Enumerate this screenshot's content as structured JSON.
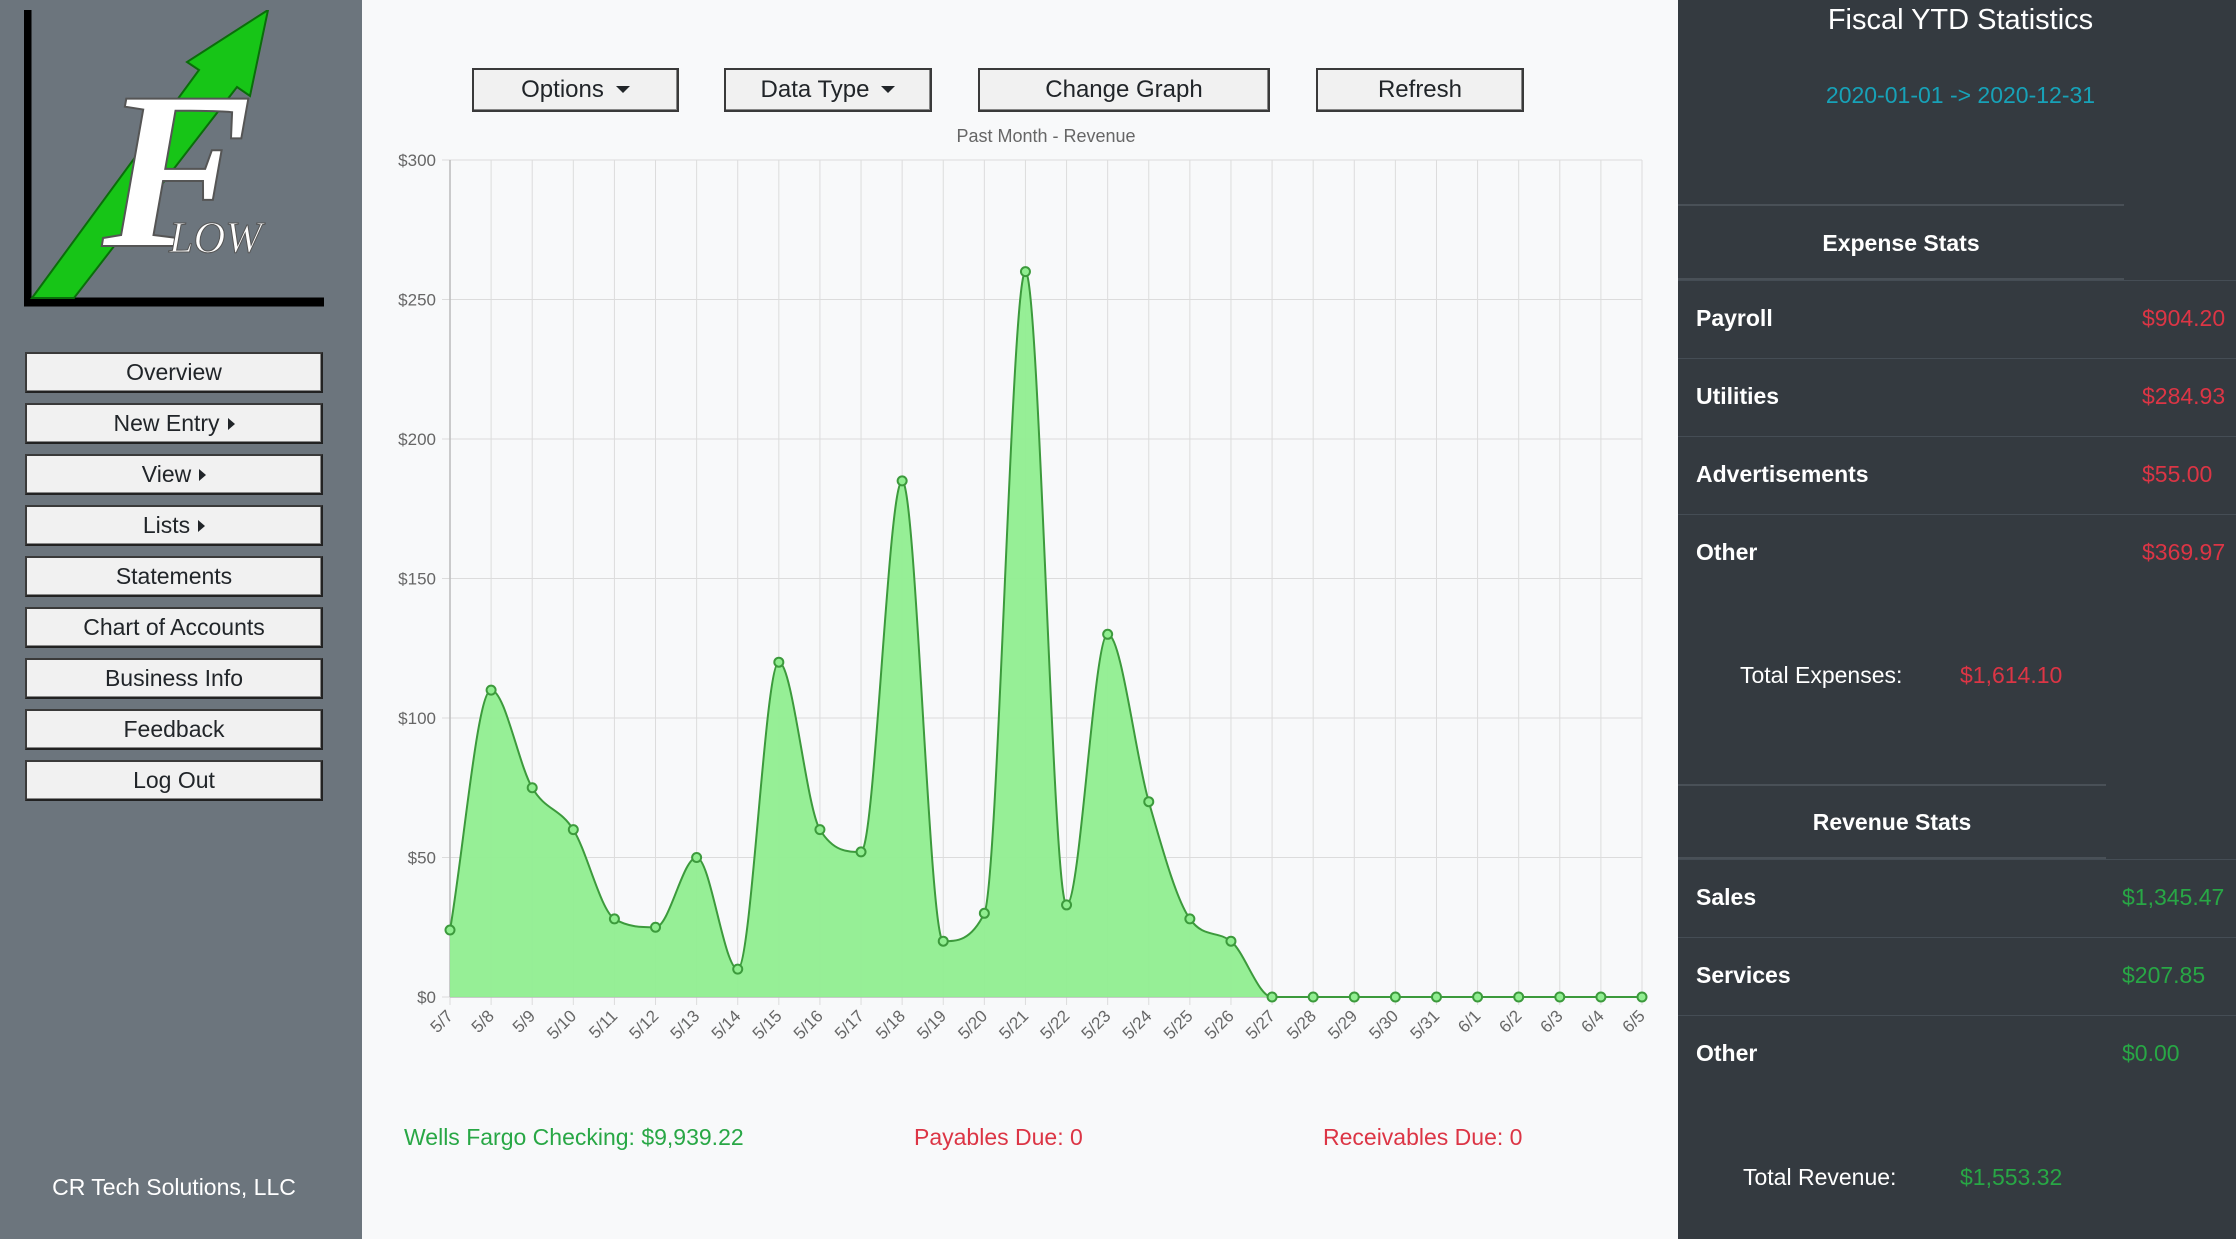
{
  "app": {
    "logo_letter": "F",
    "logo_text": "LOW",
    "company": "CR Tech Solutions, LLC"
  },
  "sidebar": {
    "items": [
      {
        "label": "Overview",
        "submenu": false
      },
      {
        "label": "New Entry",
        "submenu": true
      },
      {
        "label": "View",
        "submenu": true
      },
      {
        "label": "Lists",
        "submenu": true
      },
      {
        "label": "Statements",
        "submenu": false
      },
      {
        "label": "Chart of Accounts",
        "submenu": false
      },
      {
        "label": "Business Info",
        "submenu": false
      },
      {
        "label": "Feedback",
        "submenu": false
      },
      {
        "label": "Log Out",
        "submenu": false
      }
    ]
  },
  "toolbar": {
    "options_label": "Options",
    "data_type_label": "Data Type",
    "change_graph_label": "Change Graph",
    "refresh_label": "Refresh"
  },
  "chart_data": {
    "type": "area",
    "title": "Past Month - Revenue",
    "xlabel": "",
    "ylabel": "",
    "ylim": [
      0,
      300
    ],
    "yticks": [
      "$0",
      "$50",
      "$100",
      "$150",
      "$200",
      "$250",
      "$300"
    ],
    "grid": true,
    "fill_color": "#90ee90",
    "line_color": "#3c9a3c",
    "categories": [
      "5/7",
      "5/8",
      "5/9",
      "5/10",
      "5/11",
      "5/12",
      "5/13",
      "5/14",
      "5/15",
      "5/16",
      "5/17",
      "5/18",
      "5/19",
      "5/20",
      "5/21",
      "5/22",
      "5/23",
      "5/24",
      "5/25",
      "5/26",
      "5/27",
      "5/28",
      "5/29",
      "5/30",
      "5/31",
      "6/1",
      "6/2",
      "6/3",
      "6/4",
      "6/5"
    ],
    "values": [
      24,
      110,
      75,
      60,
      28,
      25,
      50,
      10,
      120,
      60,
      52,
      185,
      20,
      30,
      260,
      33,
      130,
      70,
      28,
      20,
      0,
      0,
      0,
      0,
      0,
      0,
      0,
      0,
      0,
      0
    ]
  },
  "footer": {
    "checking": "Wells Fargo Checking: $9,939.22",
    "payables": "Payables Due: 0",
    "receivables": "Receivables Due: 0"
  },
  "stats": {
    "title": "Fiscal YTD Statistics",
    "date_range": "2020-01-01 -> 2020-12-31",
    "expense_title": "Expense Stats",
    "expenses": [
      {
        "label": "Payroll",
        "value": "$904.20"
      },
      {
        "label": "Utilities",
        "value": "$284.93"
      },
      {
        "label": "Advertisements",
        "value": "$55.00"
      },
      {
        "label": "Other",
        "value": "$369.97"
      }
    ],
    "total_expenses_label": "Total Expenses:",
    "total_expenses": "$1,614.10",
    "revenue_title": "Revenue Stats",
    "revenue": [
      {
        "label": "Sales",
        "value": "$1,345.47"
      },
      {
        "label": "Services",
        "value": "$207.85"
      },
      {
        "label": "Other",
        "value": "$0.00"
      }
    ],
    "total_revenue_label": "Total Revenue:",
    "total_revenue": "$1,553.32",
    "colors": {
      "expense": "#dc3545",
      "revenue": "#28a745",
      "date": "#17a2b8"
    }
  }
}
